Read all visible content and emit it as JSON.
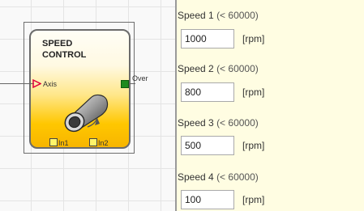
{
  "block": {
    "title": "SPEED\nCONTROL",
    "input_label": "Axis",
    "output_label": "Over",
    "in1_label": "In1",
    "in2_label": "In2"
  },
  "params": [
    {
      "label": "Speed 1",
      "limit": "(< 60000)",
      "value": "1000",
      "unit": "[rpm]"
    },
    {
      "label": "Speed 2",
      "limit": "(< 60000)",
      "value": "800",
      "unit": "[rpm]"
    },
    {
      "label": "Speed 3",
      "limit": "(< 60000)",
      "value": "500",
      "unit": "[rpm]"
    },
    {
      "label": "Speed 4",
      "limit": "(< 60000)",
      "value": "100",
      "unit": "[rpm]"
    }
  ],
  "colors": {
    "panel_bg": "#fffde2",
    "block_yellow": "#ffc700",
    "output_green": "#1e8a1e",
    "input_arrow": "#e0003c"
  },
  "icons": {
    "block_graphic": "speed-cylinder-icon",
    "input_arrow": "input-arrow-icon"
  }
}
